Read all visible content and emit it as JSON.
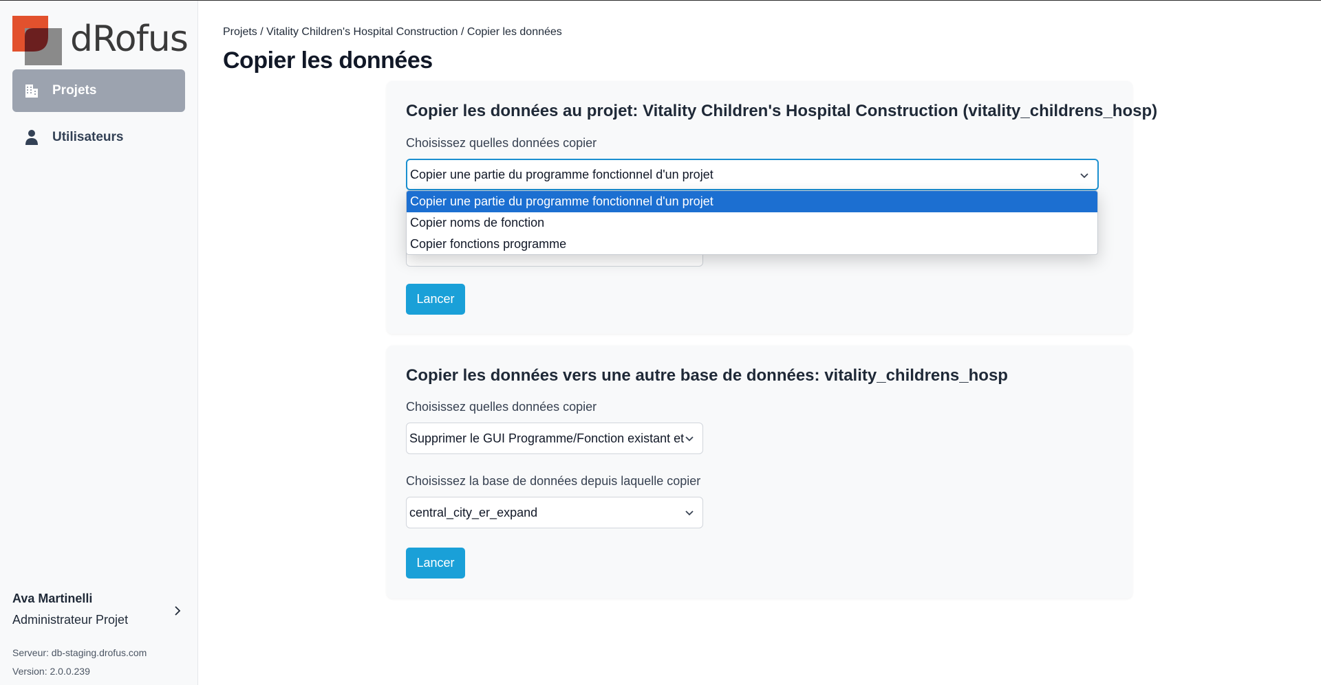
{
  "app": {
    "logo_text": "dRofus",
    "brand_colors": {
      "orange": "#e2512d",
      "dark_red": "#6b1f1f",
      "grey": "#8a8a8a"
    }
  },
  "sidebar": {
    "items": [
      {
        "label": "Projets",
        "icon": "building-icon",
        "active": true
      },
      {
        "label": "Utilisateurs",
        "icon": "user-icon",
        "active": false
      }
    ],
    "user": {
      "name": "Ava Martinelli",
      "role": "Administrateur Projet"
    },
    "server": "Serveur: db-staging.drofus.com",
    "version": "Version: 2.0.0.239"
  },
  "breadcrumb": {
    "items": [
      "Projets",
      "Vitality Children's Hospital Construction",
      "Copier les données"
    ],
    "separator": " / "
  },
  "page_title": "Copier les données",
  "card1": {
    "title": "Copier les données au projet: Vitality Children's Hospital Construction (vitality_childrens_hosp)",
    "label": "Choisissez quelles données copier",
    "select_value": "Copier une partie du programme fonctionnel d'un projet",
    "dropdown_options": [
      "Copier une partie du programme fonctionnel d'un projet",
      "Copier noms de fonction",
      "Copier fonctions programme"
    ],
    "button": "Lancer"
  },
  "card2": {
    "title": "Copier les données vers une autre base de données: vitality_childrens_hosp",
    "label1": "Choisissez quelles données copier",
    "select1_value": "Supprimer le GUI Programme/Fonction existant et",
    "label2": "Choisissez la base de données depuis laquelle copier",
    "select2_value": "central_city_er_expand",
    "button": "Lancer"
  },
  "colors": {
    "accent_button": "#1aa0d8",
    "focus_border": "#1a8fd0",
    "dropdown_selected": "#1c6fd1",
    "active_nav": "#9ca3af"
  }
}
